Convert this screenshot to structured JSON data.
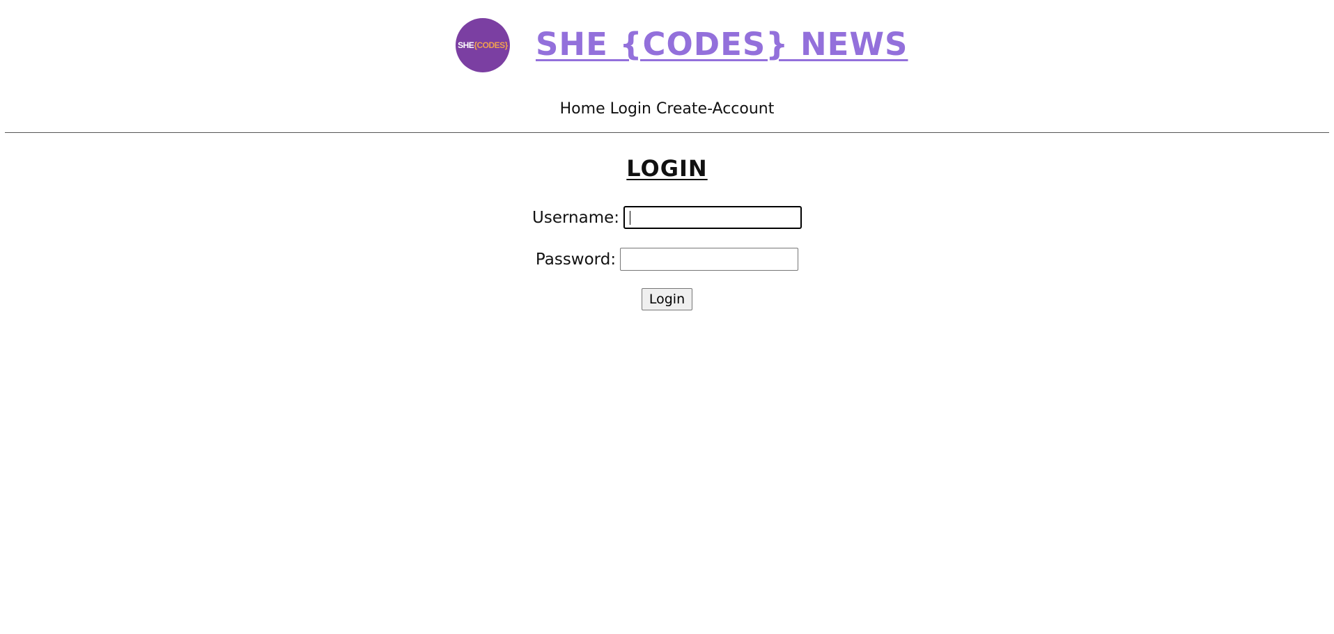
{
  "header": {
    "logo": {
      "text_she": "SHE",
      "text_codes": "{CODES}",
      "bg_color": "#7b3fa2",
      "accent_color": "#f0a050"
    },
    "title": "SHE {CODES} NEWS",
    "title_color": "#9370db"
  },
  "nav": {
    "items": [
      {
        "label": "Home"
      },
      {
        "label": "Login"
      },
      {
        "label": "Create-Account"
      }
    ]
  },
  "login": {
    "heading": "LOGIN",
    "username_label": "Username:",
    "username_value": "",
    "password_label": "Password:",
    "password_value": "",
    "submit_label": "Login"
  }
}
